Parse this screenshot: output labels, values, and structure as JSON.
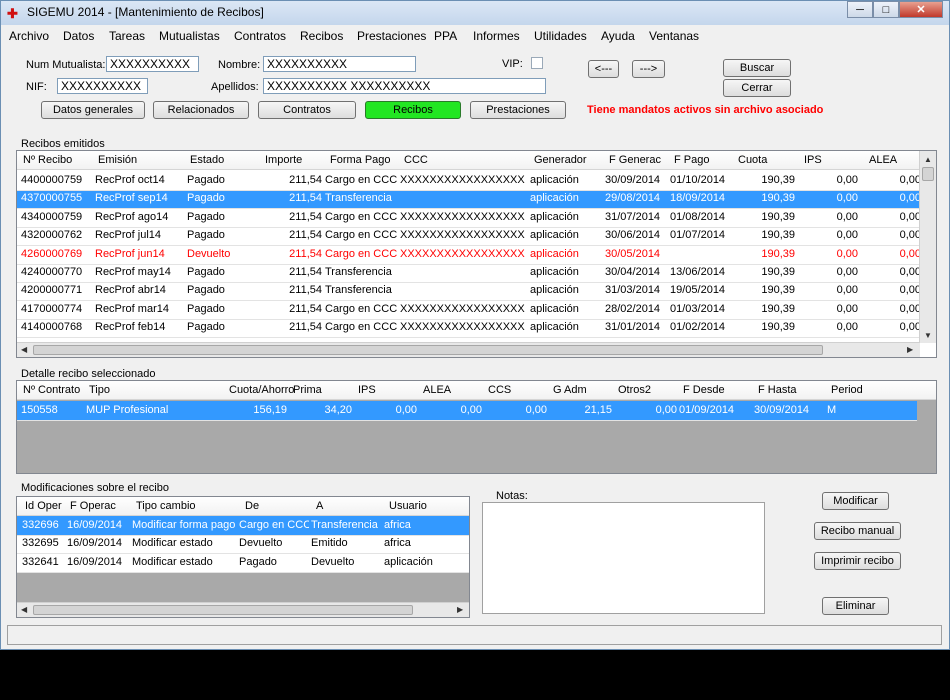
{
  "window": {
    "title": "SIGEMU 2014 - [Mantenimiento de Recibos]",
    "min": "─",
    "max": "□",
    "close": "✕"
  },
  "menu": [
    "Archivo",
    "Datos",
    "Tareas",
    "Mutualistas",
    "Contratos",
    "Recibos",
    "Prestaciones",
    "PPA",
    "Informes",
    "Utilidades",
    "Ayuda",
    "Ventanas"
  ],
  "form": {
    "num_mutualista_label": "Num Mutualista:",
    "num_mutualista_value": "XXXXXXXXXX",
    "nombre_label": "Nombre:",
    "nombre_value": "XXXXXXXXXX",
    "vip_label": "VIP:",
    "nif_label": "NIF:",
    "nif_value": "XXXXXXXXXX",
    "apellidos_label": "Apellidos:",
    "apellidos_value": "XXXXXXXXXX XXXXXXXXXX",
    "prev_button": "<---",
    "next_button": "--->",
    "buscar_button": "Buscar",
    "cerrar_button": "Cerrar"
  },
  "tabs": [
    "Datos generales",
    "Relacionados",
    "Contratos",
    "Recibos",
    "Prestaciones"
  ],
  "warning": "Tiene mandatos activos sin archivo asociado",
  "recibos": {
    "group_title": "Recibos emitidos",
    "columns": [
      "Nº Recibo",
      "Emisión",
      "Estado",
      "Importe",
      "Forma Pago",
      "CCC",
      "Generador",
      "F Generac",
      "F Pago",
      "Cuota",
      "IPS",
      "ALEA"
    ],
    "rows": [
      [
        "4400000759",
        "RecProf oct14",
        "Pagado",
        "211,54",
        "Cargo en CCC",
        "XXXXXXXXXXXXXXXXX",
        "aplicación",
        "30/09/2014",
        "01/10/2014",
        "190,39",
        "0,00",
        "0,00"
      ],
      [
        "4370000755",
        "RecProf sep14",
        "Pagado",
        "211,54",
        "Transferencia",
        "",
        "aplicación",
        "29/08/2014",
        "18/09/2014",
        "190,39",
        "0,00",
        "0,00"
      ],
      [
        "4340000759",
        "RecProf ago14",
        "Pagado",
        "211,54",
        "Cargo en CCC",
        "XXXXXXXXXXXXXXXXX",
        "aplicación",
        "31/07/2014",
        "01/08/2014",
        "190,39",
        "0,00",
        "0,00"
      ],
      [
        "4320000762",
        "RecProf jul14",
        "Pagado",
        "211,54",
        "Cargo en CCC",
        "XXXXXXXXXXXXXXXXX",
        "aplicación",
        "30/06/2014",
        "01/07/2014",
        "190,39",
        "0,00",
        "0,00"
      ],
      [
        "4260000769",
        "RecProf jun14",
        "Devuelto",
        "211,54",
        "Cargo en CCC",
        "XXXXXXXXXXXXXXXXX",
        "aplicación",
        "30/05/2014",
        "",
        "190,39",
        "0,00",
        "0,00"
      ],
      [
        "4240000770",
        "RecProf may14",
        "Pagado",
        "211,54",
        "Transferencia",
        "",
        "aplicación",
        "30/04/2014",
        "13/06/2014",
        "190,39",
        "0,00",
        "0,00"
      ],
      [
        "4200000771",
        "RecProf abr14",
        "Pagado",
        "211,54",
        "Transferencia",
        "",
        "aplicación",
        "31/03/2014",
        "19/05/2014",
        "190,39",
        "0,00",
        "0,00"
      ],
      [
        "4170000774",
        "RecProf mar14",
        "Pagado",
        "211,54",
        "Cargo en CCC",
        "XXXXXXXXXXXXXXXXX",
        "aplicación",
        "28/02/2014",
        "01/03/2014",
        "190,39",
        "0,00",
        "0,00"
      ],
      [
        "4140000768",
        "RecProf feb14",
        "Pagado",
        "211,54",
        "Cargo en CCC",
        "XXXXXXXXXXXXXXXXX",
        "aplicación",
        "31/01/2014",
        "01/02/2014",
        "190,39",
        "0,00",
        "0,00"
      ]
    ]
  },
  "detalle": {
    "group_title": "Detalle recibo seleccionado",
    "columns": [
      "Nº Contrato",
      "Tipo",
      "Cuota/Ahorro",
      "Prima",
      "IPS",
      "ALEA",
      "CCS",
      "G Adm",
      "Otros2",
      "F Desde",
      "F Hasta",
      "Period"
    ],
    "rows": [
      [
        "150558",
        "MUP Profesional",
        "156,19",
        "34,20",
        "0,00",
        "0,00",
        "0,00",
        "21,15",
        "0,00",
        "01/09/2014",
        "30/09/2014",
        "M"
      ]
    ]
  },
  "modificaciones": {
    "group_title": "Modificaciones sobre el recibo",
    "columns": [
      "Id Oper",
      "F Operac",
      "Tipo cambio",
      "De",
      "A",
      "Usuario"
    ],
    "rows": [
      [
        "332696",
        "16/09/2014",
        "Modificar forma pago",
        "Cargo en CCC",
        "Transferencia",
        "africa"
      ],
      [
        "332695",
        "16/09/2014",
        "Modificar estado",
        "Devuelto",
        "Emitido",
        "africa"
      ],
      [
        "332641",
        "16/09/2014",
        "Modificar estado",
        "Pagado",
        "Devuelto",
        "aplicación"
      ]
    ]
  },
  "notas_label": "Notas:",
  "actions": {
    "modificar": "Modificar",
    "recibo_manual": "Recibo manual",
    "imprimir": "Imprimir recibo",
    "eliminar": "Eliminar"
  },
  "colors": {
    "selection": "#3399ff",
    "active_tab": "#22e622",
    "warning": "#ff0000"
  }
}
